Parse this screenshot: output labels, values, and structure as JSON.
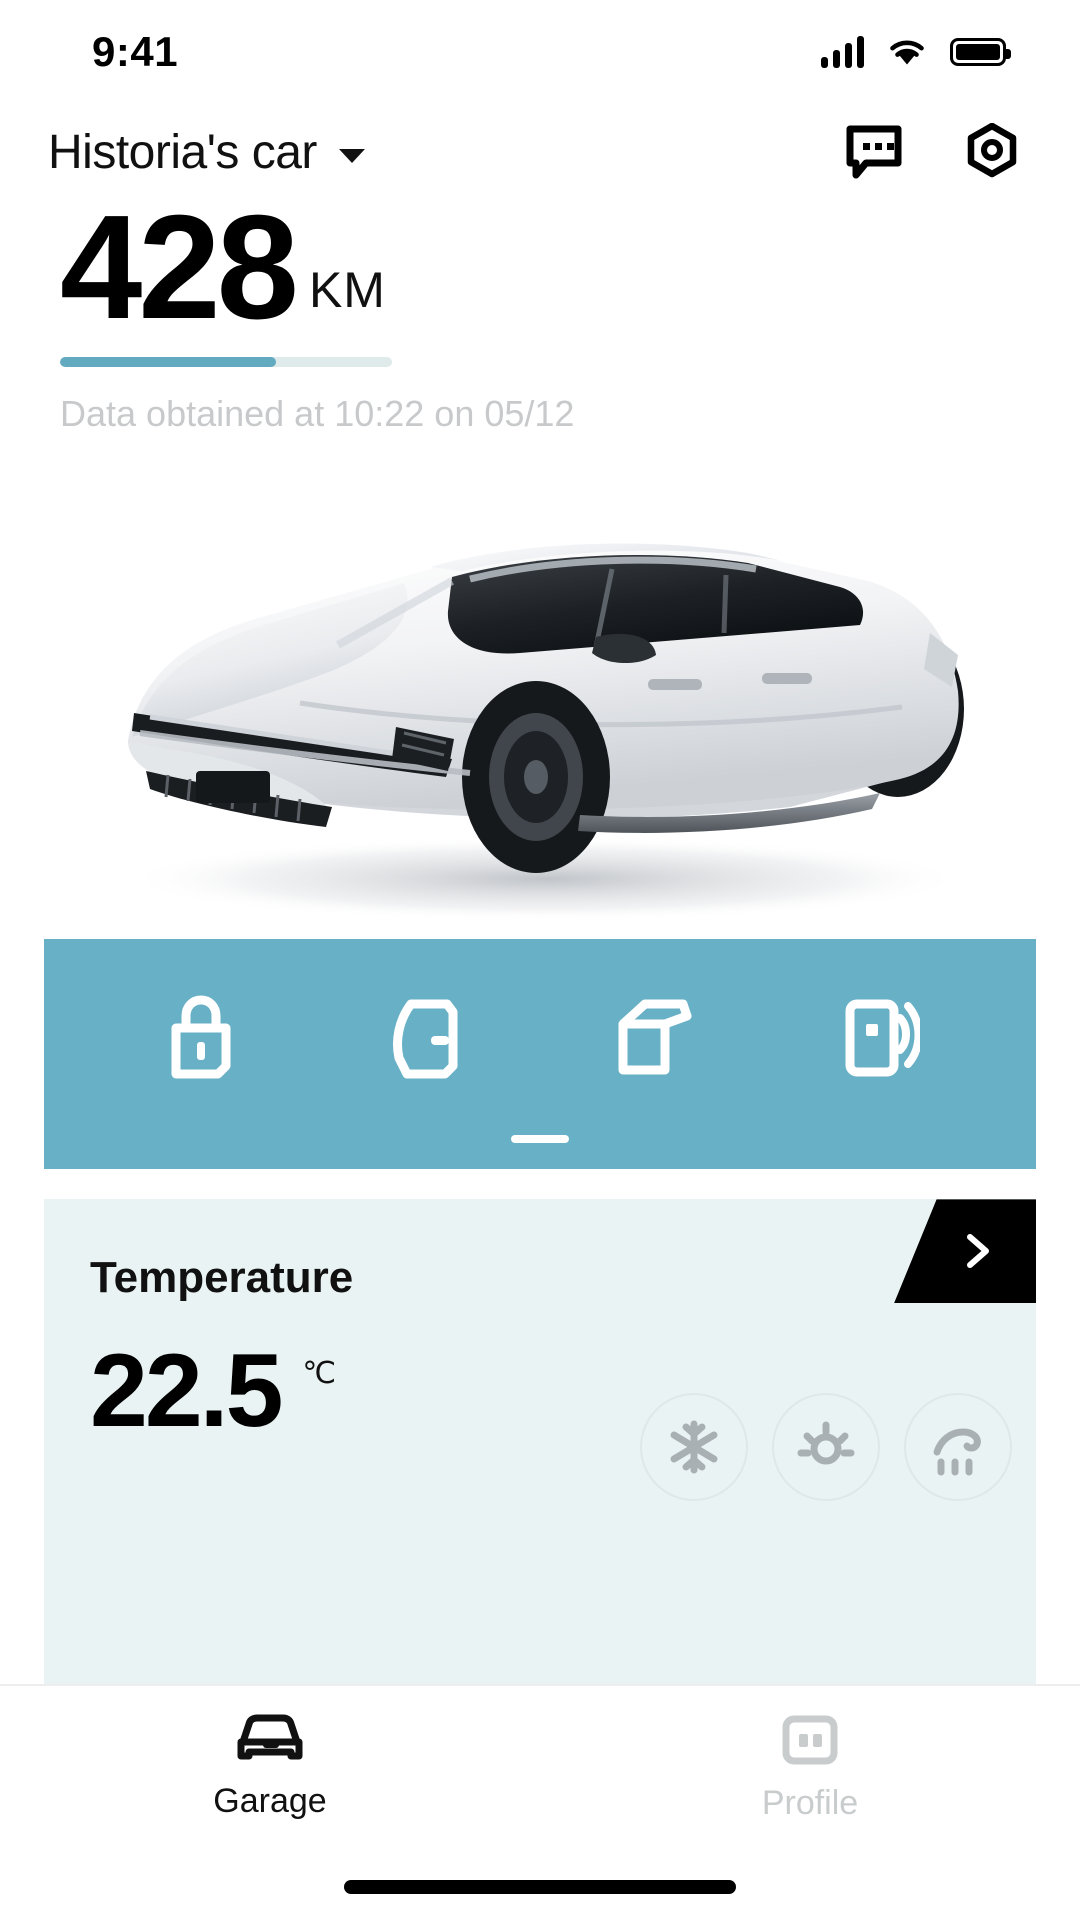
{
  "status_bar": {
    "time": "9:41",
    "signal_icon": "cellular-signal-icon",
    "wifi_icon": "wifi-icon",
    "battery_icon": "battery-full-icon"
  },
  "header": {
    "car_name": "Historia's car",
    "dropdown_icon": "chevron-down-icon",
    "message_icon": "message-bubble-icon",
    "settings_icon": "settings-gear-icon"
  },
  "range": {
    "value": "428",
    "unit": "KM",
    "battery_percent": 65,
    "bar_fill_color": "#62aabf",
    "bar_track_color": "#dfeaea",
    "timestamp_text": "Data obtained at 10:22 on 05/12"
  },
  "vehicle": {
    "image_name": "white-suv-three-quarter-view",
    "body_color": "#ffffff"
  },
  "action_bar": {
    "background_color": "#68b0c6",
    "page_indicator": "page-dash-indicator",
    "buttons": [
      {
        "name": "lock-button",
        "icon": "lock-icon"
      },
      {
        "name": "door-button",
        "icon": "car-door-icon"
      },
      {
        "name": "trunk-button",
        "icon": "trunk-open-icon"
      },
      {
        "name": "remote-button",
        "icon": "phone-key-signal-icon"
      }
    ]
  },
  "temperature_card": {
    "background_color": "#eaf3f4",
    "title": "Temperature",
    "arrow_icon": "chevron-right-icon",
    "value": "22.5",
    "unit": "℃",
    "climate_buttons": [
      {
        "name": "cooling-button",
        "icon": "snowflake-icon"
      },
      {
        "name": "heating-button",
        "icon": "sun-icon"
      },
      {
        "name": "defrost-button",
        "icon": "defrost-icon"
      }
    ]
  },
  "bottom_nav": {
    "tabs": [
      {
        "name": "tab-garage",
        "label": "Garage",
        "icon": "car-front-icon",
        "active": true
      },
      {
        "name": "tab-profile",
        "label": "Profile",
        "icon": "profile-card-icon",
        "active": false
      }
    ]
  }
}
